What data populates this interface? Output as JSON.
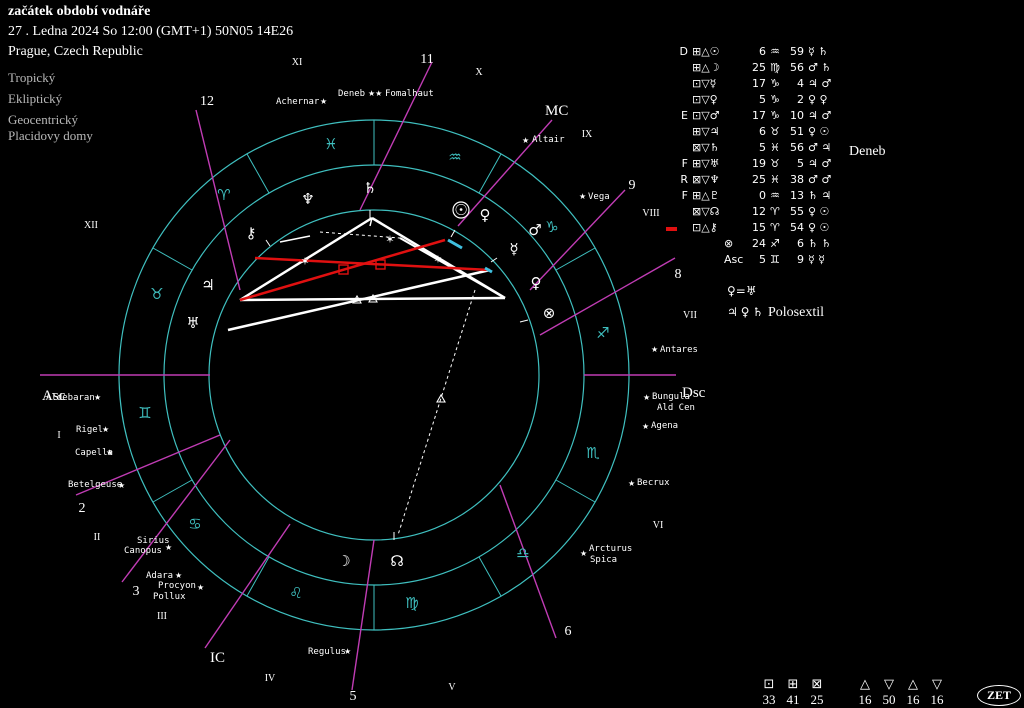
{
  "header": {
    "title": "začátek období vodnáře",
    "datetime": "27 . Ledna 2024  So  12:00 (GMT+1) 50N05  14E26",
    "place": "Prague, Czech Republic"
  },
  "options": [
    "Tropický",
    "Ekliptický",
    "Geocentrický",
    "Placidovy domy"
  ],
  "colors": {
    "ring": "#3fbfbf",
    "cusp": "#c03cb4",
    "aspect_red": "#e01010",
    "aspect_white": "#ffffff",
    "aspect_cyan": "#40c0e0"
  },
  "axes": {
    "asc": "Asc",
    "dsc": "Dsc",
    "mc": "MC",
    "ic": "IC"
  },
  "house_numbers": [
    "12",
    "11",
    "9",
    "8",
    "6",
    "5",
    "3",
    "2"
  ],
  "roman_numerals": [
    "XI",
    "X",
    "IX",
    "VIII",
    "VII",
    "VI",
    "V",
    "IV",
    "III",
    "II",
    "I",
    "XII"
  ],
  "zodiac_glyphs": [
    "♓",
    "♒",
    "♈",
    "♑",
    "♉",
    "♐",
    "♊",
    "♏",
    "♋",
    "♎",
    "♌",
    "♍"
  ],
  "planet_glyphs": [
    "♆",
    "♄",
    "☉",
    "♀",
    "☿",
    "♂",
    "⚷",
    "♅",
    "♃",
    "⊗",
    "☽",
    "☊"
  ],
  "fixed_stars": [
    "Achernar",
    "Deneb",
    "Fomalhaut",
    "Altair",
    "Vega",
    "Antares",
    "Bungula",
    "Ald Cen",
    "Agena",
    "Becrux",
    "Arcturus",
    "Spica",
    "Regulus",
    "Adara",
    "Procyon",
    "Pollux",
    "Sirius",
    "Canopus",
    "Betelgeuse",
    "Capella",
    "Rigel",
    "Aldebaran"
  ],
  "aspect_table": [
    {
      "letter": "D",
      "sym": "⊞△☉",
      "deg": "6",
      "sign": "♒",
      "mins": "59",
      "rul": "☿ ♄"
    },
    {
      "letter": "",
      "sym": "⊞△☽",
      "deg": "25",
      "sign": "♍",
      "mins": "56",
      "rul": "♂ ♄"
    },
    {
      "letter": "",
      "sym": "⊡▽☿",
      "deg": "17",
      "sign": "♑",
      "mins": "4",
      "rul": "♃ ♂"
    },
    {
      "letter": "",
      "sym": "⊡▽♀",
      "deg": "5",
      "sign": "♑",
      "mins": "2",
      "rul": "♀ ♀"
    },
    {
      "letter": "E",
      "sym": "⊡▽♂",
      "deg": "17",
      "sign": "♑",
      "mins": "10",
      "rul": "♃ ♂"
    },
    {
      "letter": "",
      "sym": "⊞▽♃",
      "deg": "6",
      "sign": "♉",
      "mins": "51",
      "rul": "♀ ☉"
    },
    {
      "letter": "",
      "sym": "⊠▽♄",
      "deg": "5",
      "sign": "♓",
      "mins": "56",
      "rul": "♂ ♃"
    },
    {
      "letter": "F",
      "sym": "⊞▽♅",
      "deg": "19",
      "sign": "♉",
      "mins": "5",
      "rul": "♃ ♂"
    },
    {
      "letter": "R",
      "sym": "⊠▽♆",
      "deg": "25",
      "sign": "♓",
      "mins": "38",
      "rul": "♂ ♂"
    },
    {
      "letter": "F",
      "sym": "⊞△♇",
      "deg": "0",
      "sign": "♒",
      "mins": "13",
      "rul": "♄ ♃"
    },
    {
      "letter": "",
      "sym": "⊠▽☊",
      "deg": "12",
      "sign": "♈",
      "mins": "55",
      "rul": "♀ ☉"
    },
    {
      "letter": "",
      "sym": "⊡△⚷",
      "deg": "15",
      "sign": "♈",
      "mins": "54",
      "rul": "♀ ☉"
    },
    {
      "letter": "",
      "sym": "⊗",
      "deg": "24",
      "sign": "♐",
      "mins": "6",
      "rul": "♄ ♄"
    },
    {
      "letter": "",
      "sym": "Asc",
      "deg": "5",
      "sign": "♊",
      "mins": "9",
      "rul": "☿ ☿"
    }
  ],
  "notes": {
    "deneb": "Deneb",
    "venus_eq": "♀=♅",
    "polosextil_glyphs": "♃♀♄",
    "polosextil": "Polosextil"
  },
  "stats": {
    "element_symbols": [
      "⊡",
      "⊞",
      "⊠"
    ],
    "element_counts": [
      "33",
      "41",
      "25"
    ],
    "triangle_symbols": [
      "△",
      "▽",
      "△",
      "▽"
    ],
    "triangle_counts": [
      "16",
      "50",
      "16",
      "16"
    ]
  },
  "footer": {
    "zet_label": "ZET"
  }
}
